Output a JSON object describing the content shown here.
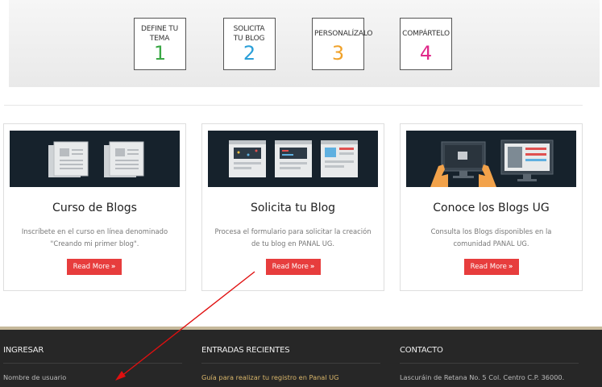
{
  "steps": [
    {
      "title": "DEFINE TU TEMA",
      "number": "1",
      "color": "#3aa845"
    },
    {
      "title": "SOLICITA TU BLOG",
      "number": "2",
      "color": "#2a9fd8"
    },
    {
      "title": "PERSONALÍZALO",
      "number": "3",
      "color": "#f0a22a"
    },
    {
      "title": "COMPÁRTELO",
      "number": "4",
      "color": "#e0288a"
    }
  ],
  "cards": [
    {
      "title": "Curso de Blogs",
      "text": "Inscríbete en el curso en línea denominado \"Creando mi primer blog\".",
      "button": "Read More",
      "icon": "documents-icon"
    },
    {
      "title": "Solicita tu Blog",
      "text": "Procesa el formulario para solicitar la creación de tu blog en PANAL UG.",
      "button": "Read More",
      "icon": "browser-windows-icon"
    },
    {
      "title": "Conoce los Blogs UG",
      "text": "Consulta los Blogs disponibles en la comunidad PANAL UG.",
      "button": "Read More",
      "icon": "computer-monitors-icon"
    }
  ],
  "footer": {
    "login": {
      "heading": "INGRESAR",
      "username_label": "Nombre de usuario"
    },
    "recent": {
      "heading": "ENTRADAS RECIENTES",
      "link": "Guía para realizar tu registro en Panal UG"
    },
    "contact": {
      "heading": "CONTACTO",
      "address": "Lascuráin de Retana No. 5 Col. Centro C.P. 36000."
    }
  },
  "colors": {
    "accent": "#e73d3d",
    "footer_bg": "#272727",
    "footer_link": "#d9b66a",
    "annotation_arrow": "#e01010"
  }
}
